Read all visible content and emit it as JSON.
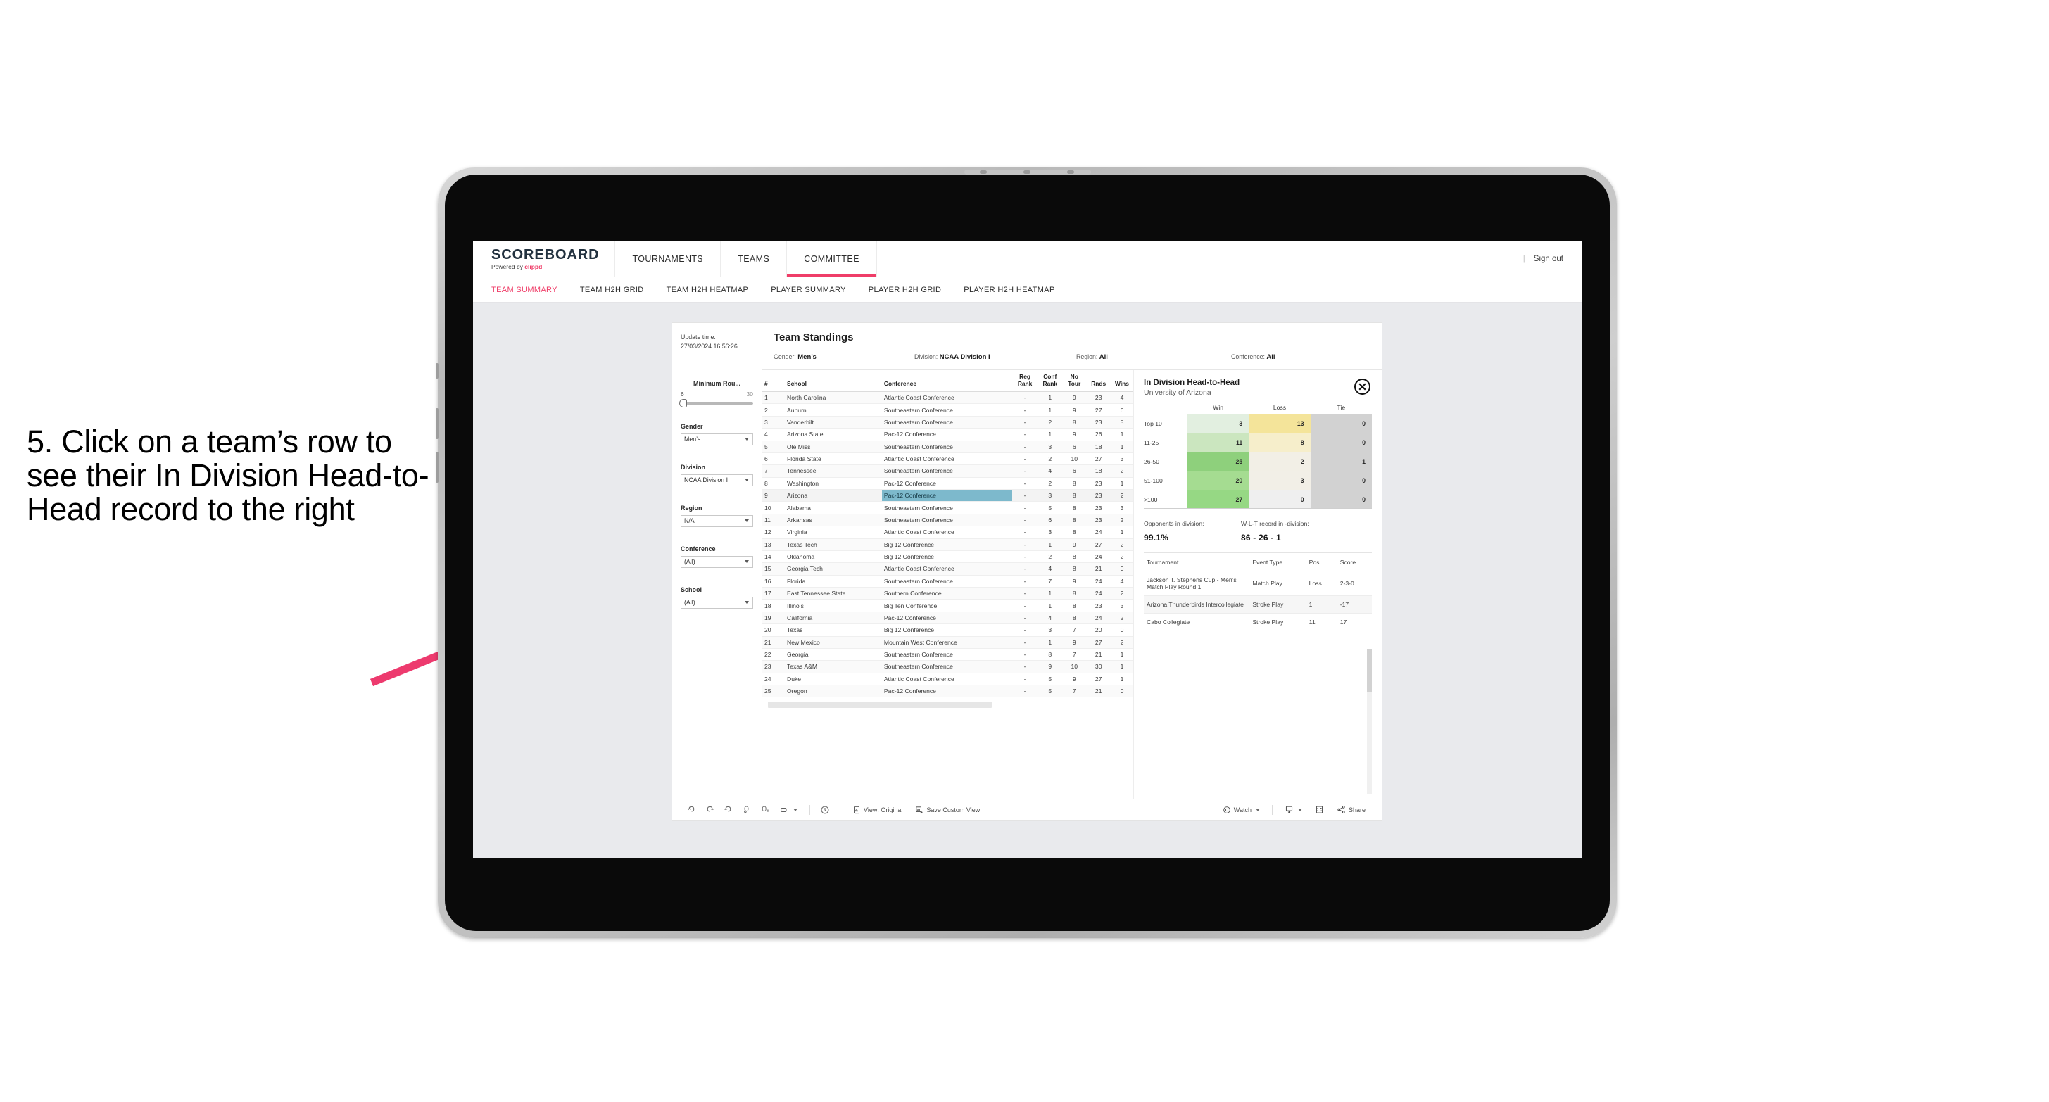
{
  "annotation": {
    "text": "5. Click on a team’s row to see their In Division Head-to-Head record to the right",
    "arrow_color": "#ED3A6E"
  },
  "header": {
    "brand_title": "SCOREBOARD",
    "brand_sub_prefix": "Powered by ",
    "brand_sub_name": "clippd",
    "nav": [
      {
        "label": "TOURNAMENTS",
        "active": false
      },
      {
        "label": "TEAMS",
        "active": false
      },
      {
        "label": "COMMITTEE",
        "active": true
      }
    ],
    "separator": "|",
    "sign_out": "Sign out"
  },
  "sub_nav": [
    {
      "label": "TEAM SUMMARY",
      "active": true
    },
    {
      "label": "TEAM H2H GRID",
      "active": false
    },
    {
      "label": "TEAM H2H HEATMAP",
      "active": false
    },
    {
      "label": "PLAYER SUMMARY",
      "active": false
    },
    {
      "label": "PLAYER H2H GRID",
      "active": false
    },
    {
      "label": "PLAYER H2H HEATMAP",
      "active": false
    }
  ],
  "filters": {
    "update_time_label": "Update time:",
    "update_time_value": "27/03/2024 16:56:26",
    "slider": {
      "label": "Minimum Rou...",
      "min": "6",
      "max": "30"
    },
    "selects": [
      {
        "label": "Gender",
        "value": "Men’s"
      },
      {
        "label": "Division",
        "value": "NCAA Division I"
      },
      {
        "label": "Region",
        "value": "N/A"
      },
      {
        "label": "Conference",
        "value": "(All)"
      },
      {
        "label": "School",
        "value": "(All)"
      }
    ]
  },
  "standings": {
    "title": "Team Standings",
    "summary": [
      {
        "label": "Gender:",
        "value": "Men’s"
      },
      {
        "label": "Division:",
        "value": "NCAA Division I"
      },
      {
        "label": "Region:",
        "value": "All"
      },
      {
        "label": "Conference:",
        "value": "All"
      }
    ],
    "columns": [
      "#",
      "School",
      "Conference",
      "Reg Rank",
      "Conf Rank",
      "No Tour",
      "Rnds",
      "Wins"
    ],
    "selected_row_index": 8,
    "rows": [
      [
        "1",
        "North Carolina",
        "Atlantic Coast Conference",
        "-",
        "1",
        "9",
        "23",
        "4"
      ],
      [
        "2",
        "Auburn",
        "Southeastern Conference",
        "-",
        "1",
        "9",
        "27",
        "6"
      ],
      [
        "3",
        "Vanderbilt",
        "Southeastern Conference",
        "-",
        "2",
        "8",
        "23",
        "5"
      ],
      [
        "4",
        "Arizona State",
        "Pac-12 Conference",
        "-",
        "1",
        "9",
        "26",
        "1"
      ],
      [
        "5",
        "Ole Miss",
        "Southeastern Conference",
        "-",
        "3",
        "6",
        "18",
        "1"
      ],
      [
        "6",
        "Florida State",
        "Atlantic Coast Conference",
        "-",
        "2",
        "10",
        "27",
        "3"
      ],
      [
        "7",
        "Tennessee",
        "Southeastern Conference",
        "-",
        "4",
        "6",
        "18",
        "2"
      ],
      [
        "8",
        "Washington",
        "Pac-12 Conference",
        "-",
        "2",
        "8",
        "23",
        "1"
      ],
      [
        "9",
        "Arizona",
        "Pac-12 Conference",
        "-",
        "3",
        "8",
        "23",
        "2"
      ],
      [
        "10",
        "Alabama",
        "Southeastern Conference",
        "-",
        "5",
        "8",
        "23",
        "3"
      ],
      [
        "11",
        "Arkansas",
        "Southeastern Conference",
        "-",
        "6",
        "8",
        "23",
        "2"
      ],
      [
        "12",
        "Virginia",
        "Atlantic Coast Conference",
        "-",
        "3",
        "8",
        "24",
        "1"
      ],
      [
        "13",
        "Texas Tech",
        "Big 12 Conference",
        "-",
        "1",
        "9",
        "27",
        "2"
      ],
      [
        "14",
        "Oklahoma",
        "Big 12 Conference",
        "-",
        "2",
        "8",
        "24",
        "2"
      ],
      [
        "15",
        "Georgia Tech",
        "Atlantic Coast Conference",
        "-",
        "4",
        "8",
        "21",
        "0"
      ],
      [
        "16",
        "Florida",
        "Southeastern Conference",
        "-",
        "7",
        "9",
        "24",
        "4"
      ],
      [
        "17",
        "East Tennessee State",
        "Southern Conference",
        "-",
        "1",
        "8",
        "24",
        "2"
      ],
      [
        "18",
        "Illinois",
        "Big Ten Conference",
        "-",
        "1",
        "8",
        "23",
        "3"
      ],
      [
        "19",
        "California",
        "Pac-12 Conference",
        "-",
        "4",
        "8",
        "24",
        "2"
      ],
      [
        "20",
        "Texas",
        "Big 12 Conference",
        "-",
        "3",
        "7",
        "20",
        "0"
      ],
      [
        "21",
        "New Mexico",
        "Mountain West Conference",
        "-",
        "1",
        "9",
        "27",
        "2"
      ],
      [
        "22",
        "Georgia",
        "Southeastern Conference",
        "-",
        "8",
        "7",
        "21",
        "1"
      ],
      [
        "23",
        "Texas A&M",
        "Southeastern Conference",
        "-",
        "9",
        "10",
        "30",
        "1"
      ],
      [
        "24",
        "Duke",
        "Atlantic Coast Conference",
        "-",
        "5",
        "9",
        "27",
        "1"
      ],
      [
        "25",
        "Oregon",
        "Pac-12 Conference",
        "-",
        "5",
        "7",
        "21",
        "0"
      ]
    ]
  },
  "detail": {
    "title": "In Division Head-to-Head",
    "subtitle": "University of Arizona",
    "close_icon": "close-circle-icon",
    "h2h_columns": [
      "",
      "Win",
      "Loss",
      "Tie"
    ],
    "h2h_rows": [
      {
        "label": "Top 10",
        "win": "3",
        "loss": "13",
        "tie": "0",
        "win_color": "#e2efe0",
        "loss_color": "#f4e49a",
        "tie_color": "#d2d2d2"
      },
      {
        "label": "11-25",
        "win": "11",
        "loss": "8",
        "tie": "0",
        "win_color": "#cbe6bf",
        "loss_color": "#f6eecb",
        "tie_color": "#d2d2d2"
      },
      {
        "label": "26-50",
        "win": "25",
        "loss": "2",
        "tie": "1",
        "win_color": "#8ed07c",
        "loss_color": "#f2efe6",
        "tie_color": "#d2d2d2"
      },
      {
        "label": "51-100",
        "win": "20",
        "loss": "3",
        "tie": "0",
        "win_color": "#a5dc91",
        "loss_color": "#f2efe7",
        "tie_color": "#d2d2d2"
      },
      {
        "label": ">100",
        "win": "27",
        "loss": "0",
        "tie": "0",
        "win_color": "#96d884",
        "loss_color": "#efefef",
        "tie_color": "#d2d2d2"
      }
    ],
    "stats": [
      {
        "label": "Opponents in division:",
        "value": "99.1%"
      },
      {
        "label": "W-L-T record in -division:",
        "value": "86 - 26 - 1"
      }
    ],
    "tournament_columns": [
      "Tournament",
      "Event Type",
      "Pos",
      "Score"
    ],
    "tournaments": [
      {
        "name": "Jackson T. Stephens Cup - Men’s Match Play Round 1",
        "type": "Match Play",
        "pos": "Loss",
        "score": "2-3-0"
      },
      {
        "name": "Arizona Thunderbirds Intercollegiate",
        "type": "Stroke Play",
        "pos": "1",
        "score": "-17"
      },
      {
        "name": "Cabo Collegiate",
        "type": "Stroke Play",
        "pos": "11",
        "score": "17"
      }
    ]
  },
  "toolbar": {
    "undo": "undo-icon",
    "redo": "redo-icon",
    "revert": "revert-icon",
    "refresh": "refresh-data-icon",
    "pause": "pause-updates-icon",
    "view_original_label": "View: Original",
    "save_custom_view_label": "Save Custom View",
    "watch_label": "Watch",
    "share_label": "Share"
  }
}
